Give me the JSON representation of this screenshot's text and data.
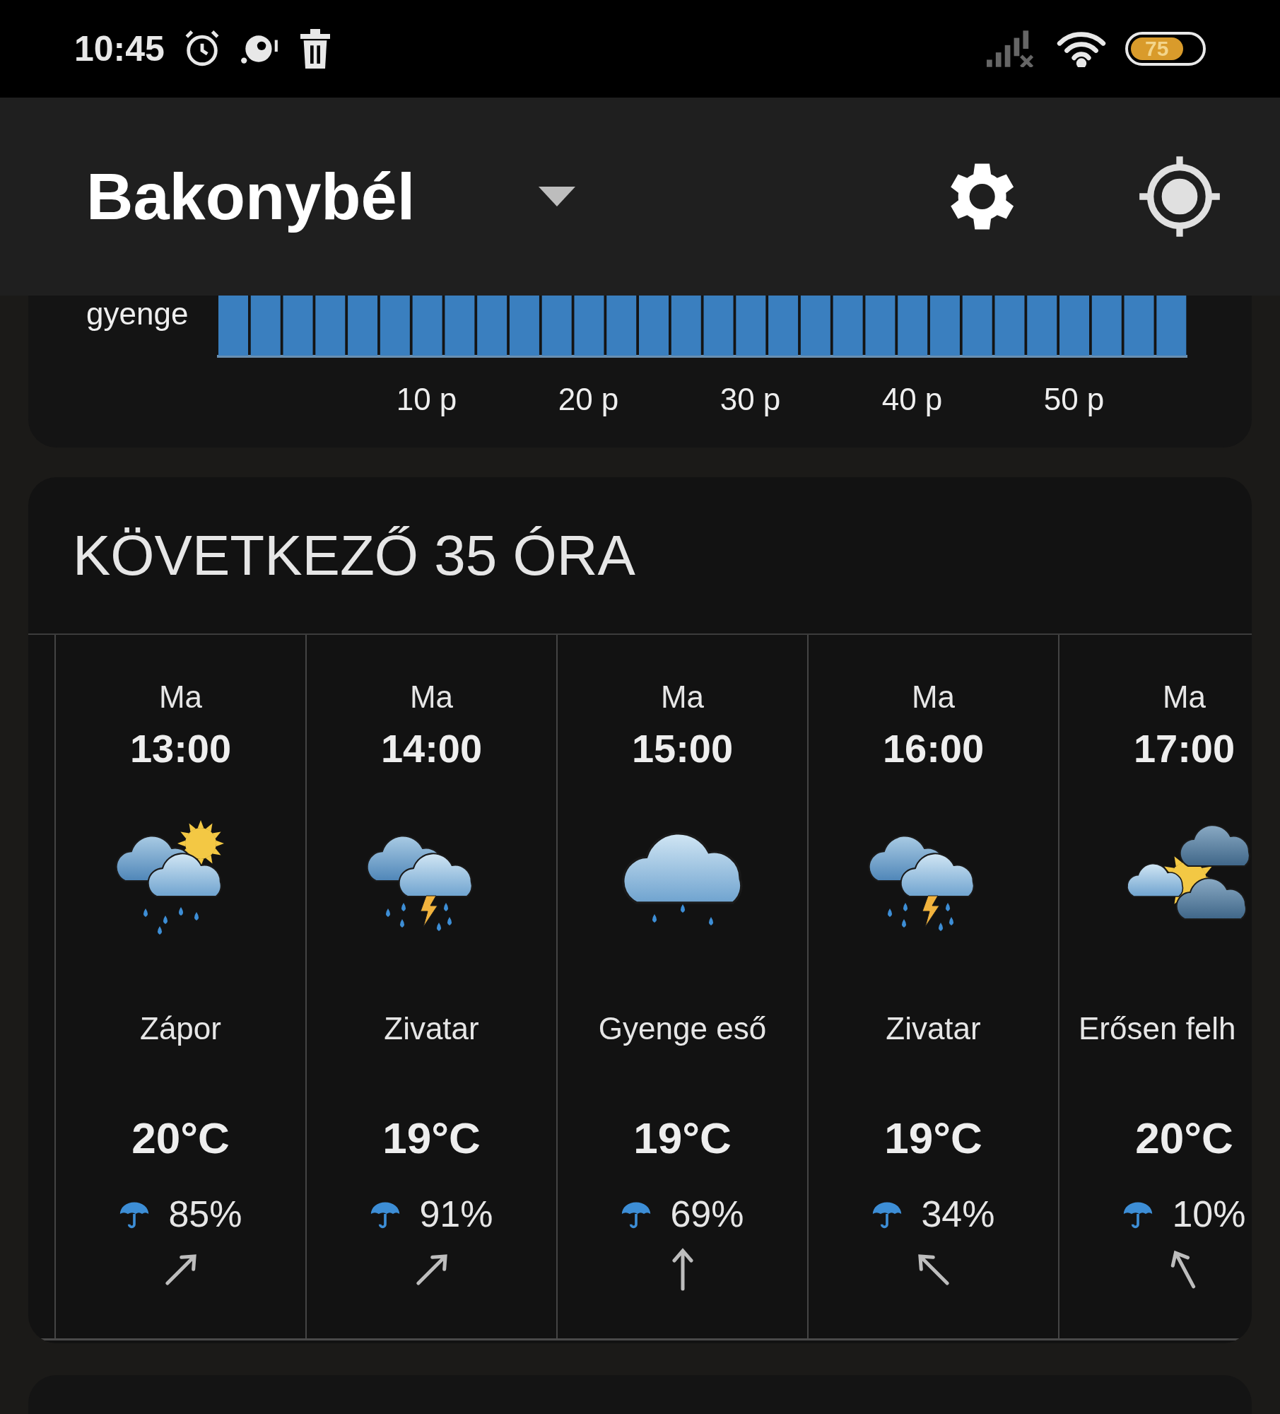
{
  "status_bar": {
    "time": "10:45",
    "battery": "75"
  },
  "header": {
    "location": "Bakonybél"
  },
  "precipitation": {
    "intensity": "gyenge",
    "ticks": [
      "10 p",
      "20 p",
      "30 p",
      "40 p",
      "50 p"
    ]
  },
  "forecast": {
    "title": "KÖVETKEZŐ 35 ÓRA",
    "hours": [
      {
        "day": "Ma",
        "time": "13:00",
        "kind": "shower",
        "condition": "Zápor",
        "temperature": "20°C",
        "precipitation": "85%",
        "wind": {
          "kind": "north-east"
        }
      },
      {
        "day": "Ma",
        "time": "14:00",
        "kind": "thunder",
        "condition": "Zivatar",
        "temperature": "19°C",
        "precipitation": "91%",
        "wind": {
          "kind": "north-east"
        }
      },
      {
        "day": "Ma",
        "time": "15:00",
        "kind": "light-rain",
        "condition": "Gyenge eső",
        "temperature": "19°C",
        "precipitation": "69%",
        "wind": {
          "kind": "north"
        }
      },
      {
        "day": "Ma",
        "time": "16:00",
        "kind": "thunder",
        "condition": "Zivatar",
        "temperature": "19°C",
        "precipitation": "34%",
        "wind": {
          "kind": "north-west"
        }
      },
      {
        "day": "Ma",
        "time": "17:00",
        "kind": "overcast",
        "condition": "Erősen felh",
        "temperature": "20°C",
        "precipitation": "10%",
        "wind": {
          "kind": "north-north-west"
        }
      }
    ]
  }
}
